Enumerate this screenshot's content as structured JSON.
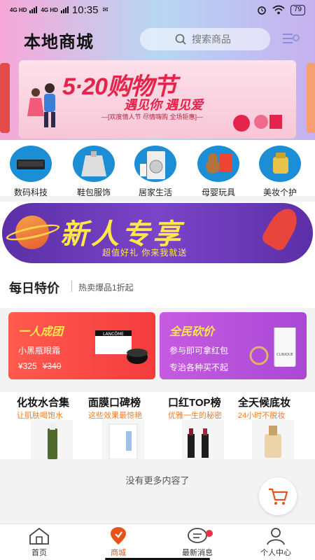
{
  "status_bar": {
    "signal1": "4G HD",
    "signal2": "4G HD",
    "time": "10:35",
    "battery": "79"
  },
  "header": {
    "title": "本地商城",
    "search_placeholder": "搜索商品"
  },
  "banner": {
    "main": "5·20购物节",
    "sub": "遇见你 遇见爱",
    "tag": "—[欢度情人节 尽情嗨购 全场钜惠]—"
  },
  "categories": [
    {
      "label": "数码科技",
      "color": "#1b8ed6"
    },
    {
      "label": "鞋包服饰",
      "color": "#1b8ed6"
    },
    {
      "label": "居家生活",
      "color": "#1b8ed6"
    },
    {
      "label": "母婴玩具",
      "color": "#1b8ed6"
    },
    {
      "label": "美妆个护",
      "color": "#1b8ed6"
    }
  ],
  "promo": {
    "title": "新人专享",
    "subtitle": "超值好礼 你来我就送"
  },
  "daily": {
    "title": "每日特价",
    "subtitle": "热卖爆品1折起"
  },
  "deals": [
    {
      "title": "一人成团",
      "line1": "小黑瓶眼霜",
      "price": "¥325",
      "old_price": "¥340",
      "brand": "LANCÔME"
    },
    {
      "title": "全民砍价",
      "line1": "参与即可拿红包",
      "line2": "专治各种买不起",
      "brand": "CLINIQUE"
    }
  ],
  "features": [
    {
      "title": "化妆水合集",
      "subtitle": "让肌肤喝饱水"
    },
    {
      "title": "面膜口碑榜",
      "subtitle": "这些效果最惊艳"
    },
    {
      "title": "口红TOP榜",
      "subtitle": "优雅一生的秘密"
    },
    {
      "title": "全天候底妆",
      "subtitle": "24小时不脱妆"
    }
  ],
  "footer_note": "没有更多内容了",
  "tabs": [
    {
      "label": "首页",
      "icon": "home-icon"
    },
    {
      "label": "商城",
      "icon": "store-icon"
    },
    {
      "label": "最新消息",
      "icon": "message-icon"
    },
    {
      "label": "个人中心",
      "icon": "user-icon"
    }
  ],
  "colors": {
    "accent": "#e8531a",
    "badge": "#ea3344",
    "deal_red": "#f43c3f",
    "deal_purple": "#b04fda",
    "promo_purple": "#5b2fa6"
  }
}
